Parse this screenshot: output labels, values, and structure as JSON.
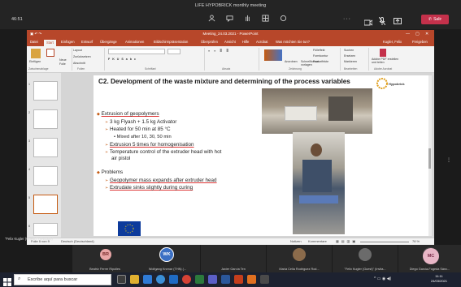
{
  "meeting": {
    "title": "LIFE HYPOBRICK monthly meeting",
    "timer": "46:51",
    "icons": [
      "people-icon",
      "chat-icon",
      "raise-hand-icon",
      "breakout-rooms-icon",
      "apps-icon",
      "more-icon",
      "camera-icon",
      "mic-icon",
      "share-icon"
    ],
    "leave_label": "Salir",
    "colors": {
      "leave": "#c4314b",
      "ppt": "#b7472a",
      "accent": "#c55a11"
    }
  },
  "ppt": {
    "window_title": "Meeting_24.03.2021 - PowerPoint",
    "user": "Kugler, Felix",
    "tabs": [
      "Datei",
      "Start",
      "Einfügen",
      "Entwurf",
      "Übergänge",
      "Animationen",
      "Bildschirmpräsentation",
      "Überprüfen",
      "Ansicht",
      "Hilfe",
      "Acrobat",
      "Was möchten Sie tun?"
    ],
    "share_label": "Freigeben",
    "ribbon": {
      "paste": "Einfügen",
      "new_slide": "Neue Folie",
      "layout": "Layout",
      "reset": "Zurücksetzen",
      "section": "Abschnitt",
      "groups": [
        "Zwischenablage",
        "Folien",
        "Schriftart",
        "Absatz",
        "Zeichnung",
        "Bearbeiten",
        "Adobe Acrobat"
      ],
      "arrange": "Anordnen",
      "quick_styles": "Schnellformat-vorlagen",
      "fill": "Fülleffekt",
      "outline": "Formkontur",
      "effects": "Formeffekte",
      "find": "Suchen",
      "replace": "Ersetzen",
      "select": "Markieren",
      "adobe": "Adobe PDF erstellen und teilen"
    },
    "slide_numbers": [
      "1",
      "2",
      "3",
      "4",
      "5",
      "6"
    ],
    "slide": {
      "title": "C2. Development of the waste mixture and determining of the process variables",
      "logo_text": "Hypobrick",
      "bullets": {
        "extrusion": "Extrusion of geopolymers",
        "mix": "3 kg Flyash + 1.5 kg Activator",
        "heated": "Heated for 50 min at 85 °C",
        "mixed": "Mixed after 10, 30, 50 min",
        "extrusion_times": "Extrusion 5 times for homogenisation",
        "temp1": "Temperature control of the extruder head with hot",
        "temp2": "air pistol",
        "problems": "Problems",
        "p1": "Geopolymer mass expands after extruder head",
        "p2": "Extrudate sinks slightly during curing"
      }
    },
    "status": {
      "slide": "Folie 5 von 9",
      "language": "Deutsch (Deutschland)",
      "notes": "Notizen",
      "comments": "Kommentare",
      "zoom": "78 %"
    }
  },
  "presenter_label": "\"Felix Kugler (Guest)\" (Invitado)",
  "participants": [
    {
      "initials": "BR",
      "name": "Beatriz Ferrer Ripolles",
      "color": "#e8a6a6"
    },
    {
      "initials": "WK",
      "name": "Wolfgang Krcmar (THN) (...",
      "color": "#3a6fc4"
    },
    {
      "initials": "",
      "name": "Javier García Ten",
      "color": "#555555"
    },
    {
      "initials": "",
      "name": "María Celia Rodríguez Rod...",
      "color": "#8b6b4b"
    },
    {
      "initials": "",
      "name": "\"Felix Kugler (Guest)\" (Invita...",
      "color": "#6b6b6b"
    },
    {
      "initials": "",
      "name": "Diego García-Fogeda Sánc...",
      "color": "#444444"
    },
    {
      "initials": "MC",
      "name": "",
      "color": "#e8b6c6"
    }
  ],
  "taskbar": {
    "search_placeholder": "Escribe aquí para buscar",
    "time": "11:11",
    "date": "24/03/2021"
  }
}
